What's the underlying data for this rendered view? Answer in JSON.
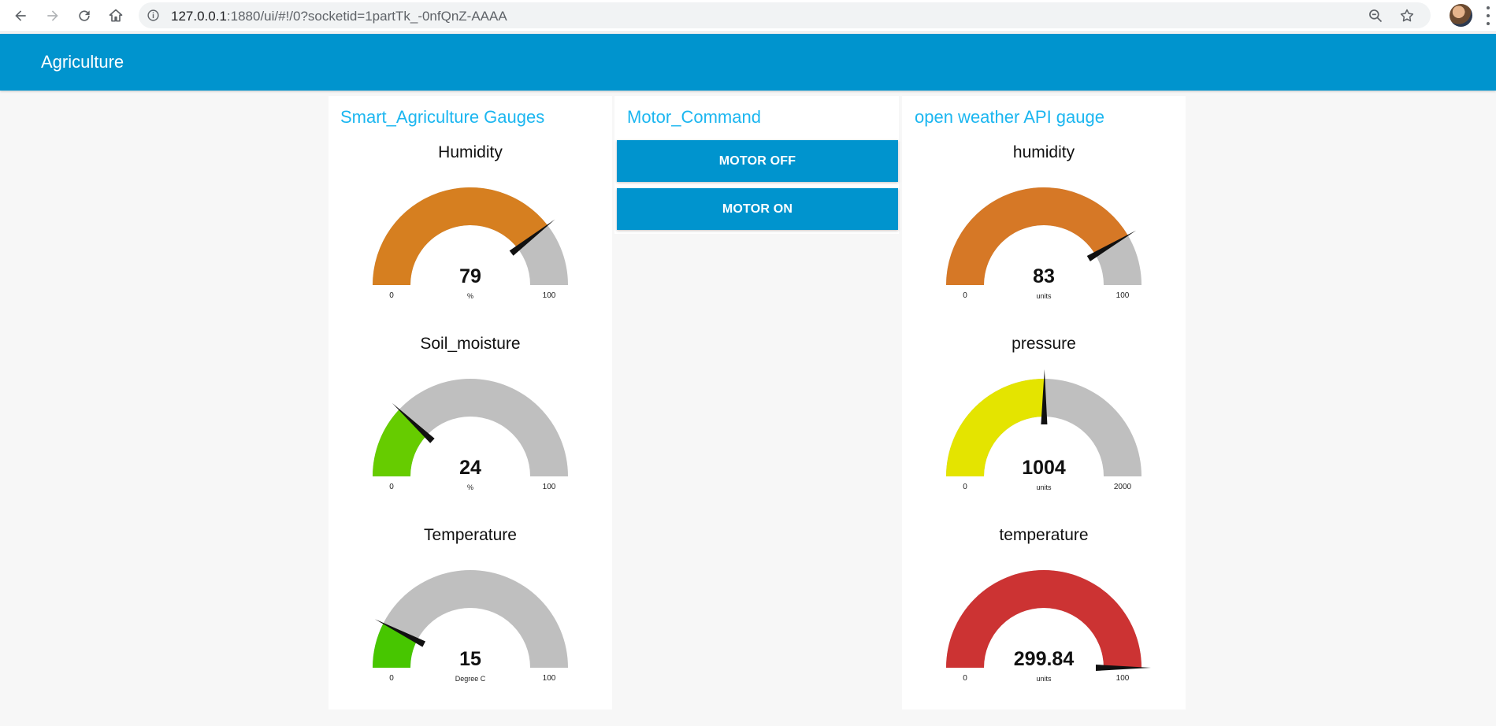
{
  "browser": {
    "url_host": "127.0.0.1",
    "url_rest": ":1880/ui/#!/0?socketid=1partTk_-0nfQnZ-AAAA"
  },
  "dashboard": {
    "title": "Agriculture",
    "accent_color": "#0094ce",
    "group_title_color": "#1bb6f0"
  },
  "groups": {
    "left": {
      "title": "Smart_Agriculture Gauges",
      "gauges": [
        {
          "label": "Humidity",
          "value": 79,
          "value_text": "79",
          "min": 0,
          "max": 100,
          "min_text": "0",
          "max_text": "100",
          "units": "%",
          "color": "#d67f20"
        },
        {
          "label": "Soil_moisture",
          "value": 24,
          "value_text": "24",
          "min": 0,
          "max": 100,
          "min_text": "0",
          "max_text": "100",
          "units": "%",
          "color": "#66cc00"
        },
        {
          "label": "Temperature",
          "value": 15,
          "value_text": "15",
          "min": 0,
          "max": 100,
          "min_text": "0",
          "max_text": "100",
          "units": "Degree C",
          "color": "#47c600"
        }
      ]
    },
    "middle": {
      "title": "Motor_Command",
      "buttons": [
        {
          "label": "MOTOR OFF"
        },
        {
          "label": "MOTOR ON"
        }
      ]
    },
    "right": {
      "title": "open weather API gauge",
      "gauges": [
        {
          "label": "humidity",
          "value": 83,
          "value_text": "83",
          "min": 0,
          "max": 100,
          "min_text": "0",
          "max_text": "100",
          "units": "units",
          "color": "#d67826"
        },
        {
          "label": "pressure",
          "value": 1004,
          "value_text": "1004",
          "min": 0,
          "max": 2000,
          "min_text": "0",
          "max_text": "2000",
          "units": "units",
          "color": "#e4e400"
        },
        {
          "label": "temperature",
          "value": 299.84,
          "value_text": "299.84",
          "min": 0,
          "max": 100,
          "min_text": "0",
          "max_text": "100",
          "units": "units",
          "color": "#cc3333"
        }
      ]
    }
  }
}
